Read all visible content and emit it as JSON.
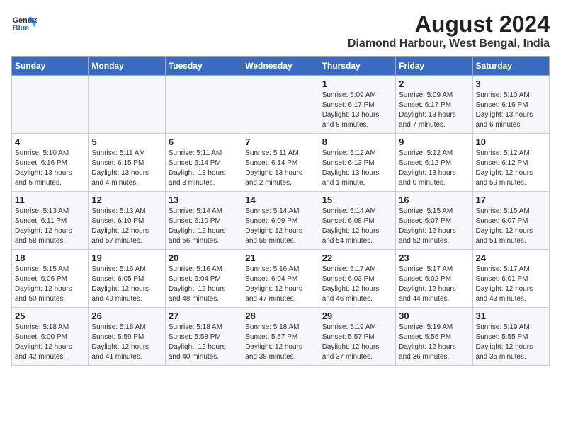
{
  "header": {
    "logo_line1": "General",
    "logo_line2": "Blue",
    "title": "August 2024",
    "subtitle": "Diamond Harbour, West Bengal, India"
  },
  "weekdays": [
    "Sunday",
    "Monday",
    "Tuesday",
    "Wednesday",
    "Thursday",
    "Friday",
    "Saturday"
  ],
  "weeks": [
    [
      {
        "day": "",
        "info": ""
      },
      {
        "day": "",
        "info": ""
      },
      {
        "day": "",
        "info": ""
      },
      {
        "day": "",
        "info": ""
      },
      {
        "day": "1",
        "info": "Sunrise: 5:09 AM\nSunset: 6:17 PM\nDaylight: 13 hours\nand 8 minutes."
      },
      {
        "day": "2",
        "info": "Sunrise: 5:09 AM\nSunset: 6:17 PM\nDaylight: 13 hours\nand 7 minutes."
      },
      {
        "day": "3",
        "info": "Sunrise: 5:10 AM\nSunset: 6:16 PM\nDaylight: 13 hours\nand 6 minutes."
      }
    ],
    [
      {
        "day": "4",
        "info": "Sunrise: 5:10 AM\nSunset: 6:16 PM\nDaylight: 13 hours\nand 5 minutes."
      },
      {
        "day": "5",
        "info": "Sunrise: 5:11 AM\nSunset: 6:15 PM\nDaylight: 13 hours\nand 4 minutes."
      },
      {
        "day": "6",
        "info": "Sunrise: 5:11 AM\nSunset: 6:14 PM\nDaylight: 13 hours\nand 3 minutes."
      },
      {
        "day": "7",
        "info": "Sunrise: 5:11 AM\nSunset: 6:14 PM\nDaylight: 13 hours\nand 2 minutes."
      },
      {
        "day": "8",
        "info": "Sunrise: 5:12 AM\nSunset: 6:13 PM\nDaylight: 13 hours\nand 1 minute."
      },
      {
        "day": "9",
        "info": "Sunrise: 5:12 AM\nSunset: 6:12 PM\nDaylight: 13 hours\nand 0 minutes."
      },
      {
        "day": "10",
        "info": "Sunrise: 5:12 AM\nSunset: 6:12 PM\nDaylight: 12 hours\nand 59 minutes."
      }
    ],
    [
      {
        "day": "11",
        "info": "Sunrise: 5:13 AM\nSunset: 6:11 PM\nDaylight: 12 hours\nand 58 minutes."
      },
      {
        "day": "12",
        "info": "Sunrise: 5:13 AM\nSunset: 6:10 PM\nDaylight: 12 hours\nand 57 minutes."
      },
      {
        "day": "13",
        "info": "Sunrise: 5:14 AM\nSunset: 6:10 PM\nDaylight: 12 hours\nand 56 minutes."
      },
      {
        "day": "14",
        "info": "Sunrise: 5:14 AM\nSunset: 6:09 PM\nDaylight: 12 hours\nand 55 minutes."
      },
      {
        "day": "15",
        "info": "Sunrise: 5:14 AM\nSunset: 6:08 PM\nDaylight: 12 hours\nand 54 minutes."
      },
      {
        "day": "16",
        "info": "Sunrise: 5:15 AM\nSunset: 6:07 PM\nDaylight: 12 hours\nand 52 minutes."
      },
      {
        "day": "17",
        "info": "Sunrise: 5:15 AM\nSunset: 6:07 PM\nDaylight: 12 hours\nand 51 minutes."
      }
    ],
    [
      {
        "day": "18",
        "info": "Sunrise: 5:15 AM\nSunset: 6:06 PM\nDaylight: 12 hours\nand 50 minutes."
      },
      {
        "day": "19",
        "info": "Sunrise: 5:16 AM\nSunset: 6:05 PM\nDaylight: 12 hours\nand 49 minutes."
      },
      {
        "day": "20",
        "info": "Sunrise: 5:16 AM\nSunset: 6:04 PM\nDaylight: 12 hours\nand 48 minutes."
      },
      {
        "day": "21",
        "info": "Sunrise: 5:16 AM\nSunset: 6:04 PM\nDaylight: 12 hours\nand 47 minutes."
      },
      {
        "day": "22",
        "info": "Sunrise: 5:17 AM\nSunset: 6:03 PM\nDaylight: 12 hours\nand 46 minutes."
      },
      {
        "day": "23",
        "info": "Sunrise: 5:17 AM\nSunset: 6:02 PM\nDaylight: 12 hours\nand 44 minutes."
      },
      {
        "day": "24",
        "info": "Sunrise: 5:17 AM\nSunset: 6:01 PM\nDaylight: 12 hours\nand 43 minutes."
      }
    ],
    [
      {
        "day": "25",
        "info": "Sunrise: 5:18 AM\nSunset: 6:00 PM\nDaylight: 12 hours\nand 42 minutes."
      },
      {
        "day": "26",
        "info": "Sunrise: 5:18 AM\nSunset: 5:59 PM\nDaylight: 12 hours\nand 41 minutes."
      },
      {
        "day": "27",
        "info": "Sunrise: 5:18 AM\nSunset: 5:58 PM\nDaylight: 12 hours\nand 40 minutes."
      },
      {
        "day": "28",
        "info": "Sunrise: 5:18 AM\nSunset: 5:57 PM\nDaylight: 12 hours\nand 38 minutes."
      },
      {
        "day": "29",
        "info": "Sunrise: 5:19 AM\nSunset: 5:57 PM\nDaylight: 12 hours\nand 37 minutes."
      },
      {
        "day": "30",
        "info": "Sunrise: 5:19 AM\nSunset: 5:56 PM\nDaylight: 12 hours\nand 36 minutes."
      },
      {
        "day": "31",
        "info": "Sunrise: 5:19 AM\nSunset: 5:55 PM\nDaylight: 12 hours\nand 35 minutes."
      }
    ]
  ]
}
